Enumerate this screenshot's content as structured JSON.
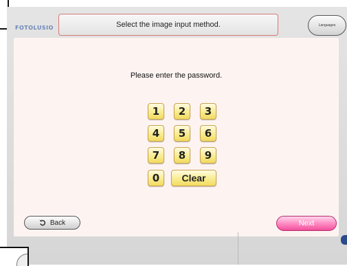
{
  "header": {
    "logo": "FOTOLUSIO",
    "title": "Select the image input method.",
    "language_button": "Languages"
  },
  "main": {
    "prompt": "Please enter the password.",
    "keypad": [
      "1",
      "2",
      "3",
      "4",
      "5",
      "6",
      "7",
      "8",
      "9",
      "0"
    ],
    "clear_label": "Clear"
  },
  "footer": {
    "back_label": "Back",
    "next_label": "Next"
  },
  "colors": {
    "key_fill": "#f9ec8f",
    "next_fill": "#ff86c0",
    "title_border": "#d77777"
  },
  "icons": {
    "back": "rotate-ccw-icon"
  }
}
